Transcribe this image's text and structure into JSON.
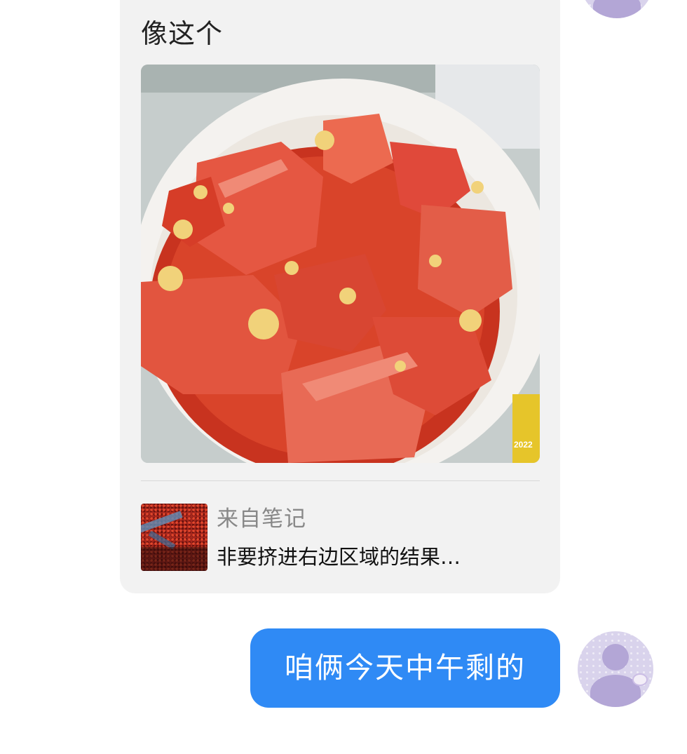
{
  "chat": {
    "incoming_card": {
      "caption": "像这个",
      "photo_icon": "tomato-egg-dish-photo",
      "photo_watermark": "2022",
      "source": {
        "label": "来自笔记",
        "title": "非要挤进右边区域的结果…"
      }
    },
    "outgoing_message": {
      "text": "咱俩今天中午剩的"
    }
  },
  "colors": {
    "background": "#ffffff",
    "card_background": "#f2f2f2",
    "bubble_blue": "#2f8af5",
    "avatar_lavender": "#d9d3ec"
  }
}
